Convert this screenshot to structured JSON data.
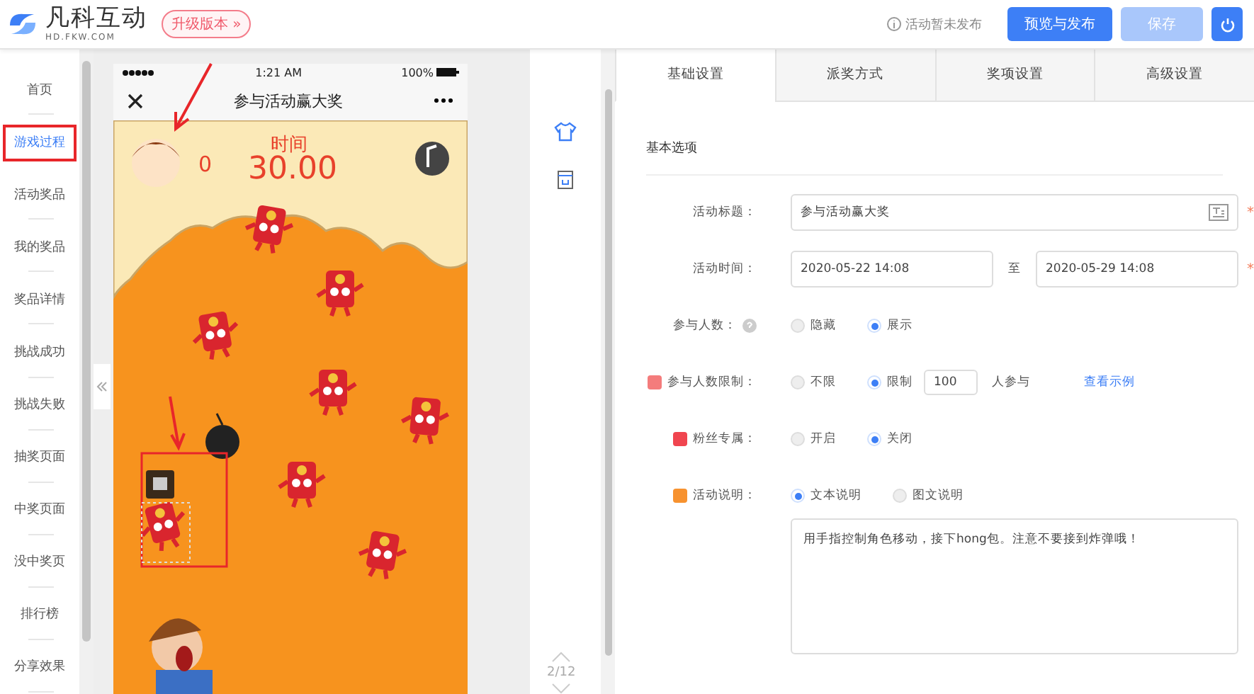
{
  "header": {
    "logo_text": "凡科互动",
    "logo_subtext": "HD.FKW.COM",
    "upgrade_button": "升级版本 »",
    "status": "活动暂未发布",
    "buttons": [
      {
        "label": "预览与发布",
        "disabled": false
      },
      {
        "label": "保存",
        "disabled": true
      }
    ]
  },
  "sidebar": {
    "items": [
      {
        "label": "首页",
        "selected": false
      },
      {
        "label": "游戏过程",
        "selected": true
      },
      {
        "label": "活动奖品",
        "selected": false
      },
      {
        "label": "我的奖品",
        "selected": false
      },
      {
        "label": "奖品详情",
        "selected": false
      },
      {
        "label": "挑战成功",
        "selected": false
      },
      {
        "label": "挑战失败",
        "selected": false
      },
      {
        "label": "抽奖页面",
        "selected": false
      },
      {
        "label": "中奖页面",
        "selected": false
      },
      {
        "label": "没中奖页",
        "selected": false
      },
      {
        "label": "排行榜",
        "selected": false
      },
      {
        "label": "分享效果",
        "selected": false
      }
    ]
  },
  "phone": {
    "time": "1:21 AM",
    "battery": "100%",
    "title": "参与活动赢大奖",
    "score": "0",
    "timer_label": "时间",
    "timer": "30.00"
  },
  "pager": "2/12",
  "tabs": [
    {
      "label": "基础设置",
      "selected": true
    },
    {
      "label": "派奖方式",
      "selected": false
    },
    {
      "label": "奖项设置",
      "selected": false
    },
    {
      "label": "高级设置",
      "selected": false
    }
  ],
  "section_title": "基本选项",
  "form": [
    {
      "kind": "text",
      "label": "活动标题：",
      "value": "参与活动赢大奖",
      "required_mark": "*"
    },
    {
      "kind": "daterange",
      "label": "活动时间：",
      "start": "2020-05-22 14:08",
      "separator": "至",
      "end": "2020-05-29 14:08",
      "required_mark": "*"
    },
    {
      "kind": "radio",
      "label": "参与人数：",
      "help": true,
      "options": [
        {
          "label": "隐藏",
          "selected": false
        },
        {
          "label": "展示",
          "selected": true
        }
      ]
    },
    {
      "kind": "limit",
      "label": "参与人数限制：",
      "color": "#f47c7c",
      "options": [
        {
          "label": "不限",
          "selected": false
        },
        {
          "label": "限制",
          "selected": true
        }
      ],
      "value": "100",
      "suffix": "人参与",
      "link": "查看示例"
    },
    {
      "kind": "radio",
      "label": "粉丝专属：",
      "color": "#f0454f",
      "options": [
        {
          "label": "开启",
          "selected": false
        },
        {
          "label": "关闭",
          "selected": true
        }
      ]
    },
    {
      "kind": "radio",
      "label": "活动说明：",
      "color": "#f7922f",
      "options": [
        {
          "label": "文本说明",
          "selected": true
        },
        {
          "label": "图文说明",
          "selected": false
        }
      ]
    },
    {
      "kind": "textarea",
      "value": "用手指控制角色移动，接下hong包。注意不要接到炸弹哦！"
    }
  ]
}
